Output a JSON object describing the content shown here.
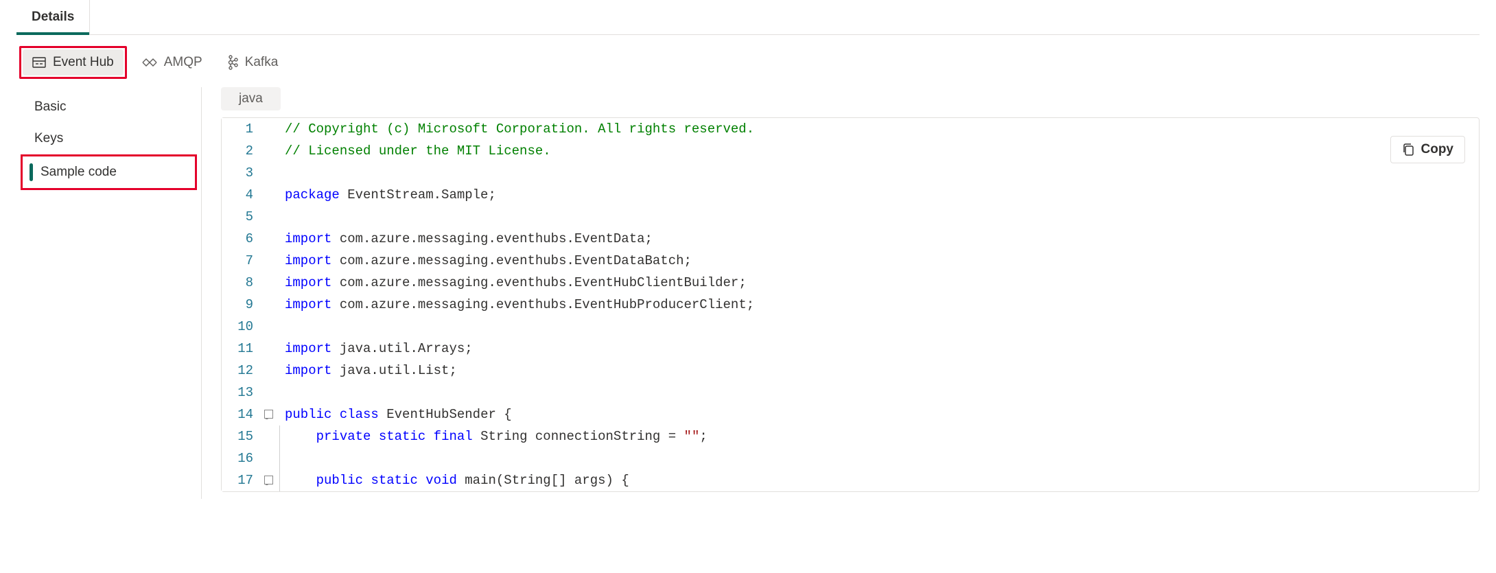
{
  "top": {
    "tabs": [
      {
        "label": "Details",
        "active": true
      }
    ]
  },
  "protocols": [
    {
      "name": "event-hub",
      "label": "Event Hub",
      "active": true,
      "highlight": true
    },
    {
      "name": "amqp",
      "label": "AMQP",
      "active": false,
      "highlight": false
    },
    {
      "name": "kafka",
      "label": "Kafka",
      "active": false,
      "highlight": false
    }
  ],
  "sidebar": {
    "items": [
      {
        "label": "Basic",
        "active": false,
        "highlight": false
      },
      {
        "label": "Keys",
        "active": false,
        "highlight": false
      },
      {
        "label": "Sample code",
        "active": true,
        "highlight": true
      }
    ]
  },
  "language_badge": "java",
  "copy_label": "Copy",
  "code": {
    "lines": [
      {
        "n": 1,
        "fold": "",
        "guide": false,
        "tokens": [
          {
            "t": "// Copyright (c) Microsoft Corporation. All rights reserved.",
            "c": "c-comment"
          }
        ]
      },
      {
        "n": 2,
        "fold": "",
        "guide": false,
        "tokens": [
          {
            "t": "// Licensed under the MIT License.",
            "c": "c-comment"
          }
        ]
      },
      {
        "n": 3,
        "fold": "",
        "guide": false,
        "tokens": [
          {
            "t": " ",
            "c": ""
          }
        ]
      },
      {
        "n": 4,
        "fold": "",
        "guide": false,
        "tokens": [
          {
            "t": "package",
            "c": "c-kw"
          },
          {
            "t": " EventStream.Sample;",
            "c": ""
          }
        ]
      },
      {
        "n": 5,
        "fold": "",
        "guide": false,
        "tokens": [
          {
            "t": " ",
            "c": ""
          }
        ]
      },
      {
        "n": 6,
        "fold": "",
        "guide": false,
        "tokens": [
          {
            "t": "import",
            "c": "c-kw"
          },
          {
            "t": " com.azure.messaging.eventhubs.EventData;",
            "c": ""
          }
        ]
      },
      {
        "n": 7,
        "fold": "",
        "guide": false,
        "tokens": [
          {
            "t": "import",
            "c": "c-kw"
          },
          {
            "t": " com.azure.messaging.eventhubs.EventDataBatch;",
            "c": ""
          }
        ]
      },
      {
        "n": 8,
        "fold": "",
        "guide": false,
        "tokens": [
          {
            "t": "import",
            "c": "c-kw"
          },
          {
            "t": " com.azure.messaging.eventhubs.EventHubClientBuilder;",
            "c": ""
          }
        ]
      },
      {
        "n": 9,
        "fold": "",
        "guide": false,
        "tokens": [
          {
            "t": "import",
            "c": "c-kw"
          },
          {
            "t": " com.azure.messaging.eventhubs.EventHubProducerClient;",
            "c": ""
          }
        ]
      },
      {
        "n": 10,
        "fold": "",
        "guide": false,
        "tokens": [
          {
            "t": " ",
            "c": ""
          }
        ]
      },
      {
        "n": 11,
        "fold": "",
        "guide": false,
        "tokens": [
          {
            "t": "import",
            "c": "c-kw"
          },
          {
            "t": " java.util.Arrays;",
            "c": ""
          }
        ]
      },
      {
        "n": 12,
        "fold": "",
        "guide": false,
        "tokens": [
          {
            "t": "import",
            "c": "c-kw"
          },
          {
            "t": " java.util.List;",
            "c": ""
          }
        ]
      },
      {
        "n": 13,
        "fold": "",
        "guide": false,
        "tokens": [
          {
            "t": " ",
            "c": ""
          }
        ]
      },
      {
        "n": 14,
        "fold": "box",
        "guide": false,
        "tokens": [
          {
            "t": "public",
            "c": "c-kw"
          },
          {
            "t": " ",
            "c": ""
          },
          {
            "t": "class",
            "c": "c-kw"
          },
          {
            "t": " EventHubSender {",
            "c": ""
          }
        ]
      },
      {
        "n": 15,
        "fold": "",
        "guide": true,
        "tokens": [
          {
            "t": "    ",
            "c": ""
          },
          {
            "t": "private",
            "c": "c-kw"
          },
          {
            "t": " ",
            "c": ""
          },
          {
            "t": "static",
            "c": "c-kw"
          },
          {
            "t": " ",
            "c": ""
          },
          {
            "t": "final",
            "c": "c-kw"
          },
          {
            "t": " String connectionString = ",
            "c": ""
          },
          {
            "t": "\"\"",
            "c": "c-str"
          },
          {
            "t": ";",
            "c": ""
          }
        ]
      },
      {
        "n": 16,
        "fold": "",
        "guide": true,
        "tokens": [
          {
            "t": " ",
            "c": ""
          }
        ]
      },
      {
        "n": 17,
        "fold": "box",
        "guide": true,
        "tokens": [
          {
            "t": "    ",
            "c": ""
          },
          {
            "t": "public",
            "c": "c-kw"
          },
          {
            "t": " ",
            "c": ""
          },
          {
            "t": "static",
            "c": "c-kw"
          },
          {
            "t": " ",
            "c": ""
          },
          {
            "t": "void",
            "c": "c-kw"
          },
          {
            "t": " main(String[] args) {",
            "c": ""
          }
        ]
      }
    ]
  }
}
